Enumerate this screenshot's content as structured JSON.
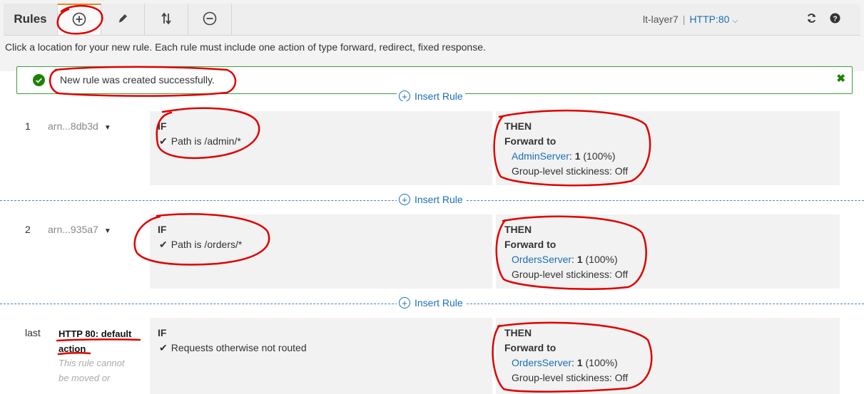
{
  "toolbar": {
    "title": "Rules",
    "buttons": [
      {
        "name": "add-rule",
        "icon": "plus-circle-icon"
      },
      {
        "name": "edit-rules",
        "icon": "pencil-icon"
      },
      {
        "name": "reorder-rules",
        "icon": "sort-arrows-icon"
      },
      {
        "name": "delete-rules",
        "icon": "minus-circle-icon"
      }
    ],
    "load_balancer": "lt-layer7",
    "separator": "|",
    "listener": "HTTP:80",
    "refresh_icon": "refresh-icon",
    "help_icon": "help-icon"
  },
  "hint": "Click a location for your new rule. Each rule must include one action of type forward, redirect, fixed response.",
  "alert": {
    "message": "New rule was created successfully.",
    "status": "success",
    "icon": "check-circle-icon",
    "close_icon": "close-icon"
  },
  "insert_label": "Insert Rule",
  "rules": [
    {
      "number": "1",
      "arn": "arn...8db3d",
      "if_title": "IF",
      "condition": "Path is /admin/*",
      "then_title": "THEN",
      "action": "Forward to",
      "target": "AdminServer",
      "target_suffix": ":",
      "weight": "1",
      "weight_pct": "(100%)",
      "stickiness": "Group-level stickiness: Off"
    },
    {
      "number": "2",
      "arn": "arn...935a7",
      "if_title": "IF",
      "condition": "Path is /orders/*",
      "then_title": "THEN",
      "action": "Forward to",
      "target": "OrdersServer",
      "target_suffix": ":",
      "weight": "1",
      "weight_pct": "(100%)",
      "stickiness": "Group-level stickiness: Off"
    },
    {
      "number": "last",
      "name_line1": "HTTP 80: default",
      "name_line2": "action",
      "note_line1": "This rule cannot",
      "note_line2": "be moved or",
      "if_title": "IF",
      "condition": "Requests otherwise not routed",
      "then_title": "THEN",
      "action": "Forward to",
      "target": "OrdersServer",
      "target_suffix": ":",
      "weight": "1",
      "weight_pct": "(100%)",
      "stickiness": "Group-level stickiness: Off"
    }
  ],
  "colors": {
    "accent": "#e8891d",
    "link": "#1a6fb5",
    "success": "#1d8102",
    "annotation": "#e00000"
  }
}
